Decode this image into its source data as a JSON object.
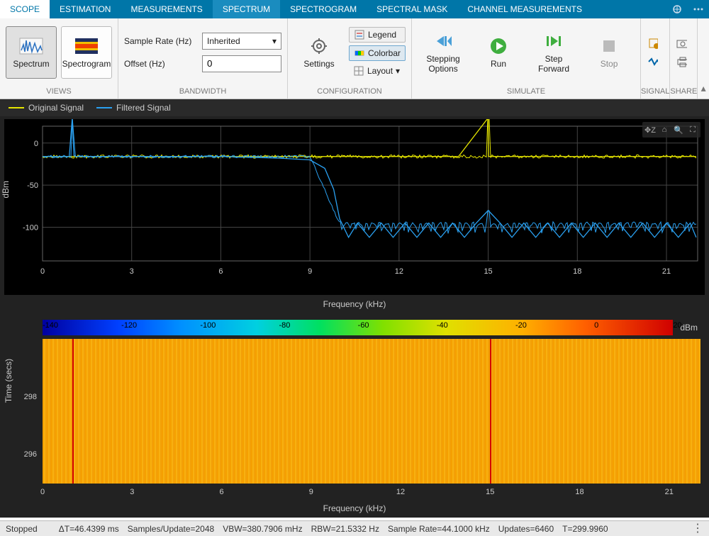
{
  "tabs": {
    "items": [
      "SCOPE",
      "ESTIMATION",
      "MEASUREMENTS",
      "SPECTRUM",
      "SPECTROGRAM",
      "SPECTRAL MASK",
      "CHANNEL MEASUREMENTS"
    ],
    "active_index": 0,
    "highlight_index": 3
  },
  "ribbon": {
    "views": {
      "label": "VIEWS",
      "spectrum_btn": "Spectrum",
      "spectrogram_btn": "Spectrogram"
    },
    "bandwidth": {
      "label": "BANDWIDTH",
      "sample_rate_label": "Sample Rate (Hz)",
      "sample_rate_value": "Inherited",
      "offset_label": "Offset (Hz)",
      "offset_value": "0"
    },
    "configuration": {
      "label": "CONFIGURATION",
      "settings": "Settings",
      "legend": "Legend",
      "colorbar": "Colorbar",
      "layout": "Layout"
    },
    "simulate": {
      "label": "SIMULATE",
      "stepping": "Stepping\nOptions",
      "run": "Run",
      "step_forward": "Step\nForward",
      "stop": "Stop"
    },
    "signal": {
      "label": "SIGNAL"
    },
    "share": {
      "label": "SHARE"
    }
  },
  "legend": {
    "items": [
      {
        "name": "Original Signal",
        "color": "#e6e600"
      },
      {
        "name": "Filtered Signal",
        "color": "#2aa0f0"
      }
    ]
  },
  "chart_data": [
    {
      "type": "line",
      "title": "",
      "xlabel": "Frequency (kHz)",
      "ylabel": "dBm",
      "xlim": [
        0,
        22.05
      ],
      "ylim": [
        -140,
        20
      ],
      "xticks": [
        0,
        3,
        6,
        9,
        12,
        15,
        18,
        21
      ],
      "yticks": [
        0,
        -50,
        -100
      ],
      "series": [
        {
          "name": "Original Signal",
          "color": "#e6e600",
          "x": [
            0,
            1,
            1.01,
            2,
            4,
            6,
            8,
            10,
            12,
            14,
            15,
            15.01,
            16,
            18,
            20,
            22
          ],
          "y": [
            -16,
            -16,
            -16,
            -16,
            -16,
            -16,
            -16,
            -16,
            -16,
            -16,
            30,
            -16,
            -16,
            -16,
            -16,
            -16
          ]
        },
        {
          "name": "Filtered Signal",
          "color": "#2aa0f0",
          "envelope_baseline": true,
          "x": [
            0,
            0.9,
            1,
            1.1,
            2,
            4,
            6,
            8,
            9,
            9.5,
            9.8,
            10,
            10.3,
            10.6,
            11,
            11.4,
            11.8,
            12.2,
            12.6,
            13,
            13.4,
            13.8,
            14.2,
            14.6,
            15,
            15.4,
            15.8,
            16.2,
            16.6,
            17,
            17.4,
            17.8,
            18.2,
            18.6,
            19,
            19.4,
            19.8,
            20.2,
            20.6,
            21,
            21.4,
            21.8,
            22
          ],
          "y": [
            -16,
            -16,
            30,
            -16,
            -16,
            -16,
            -16,
            -18,
            -20,
            -30,
            -55,
            -90,
            -112,
            -95,
            -112,
            -95,
            -112,
            -95,
            -112,
            -95,
            -112,
            -95,
            -112,
            -95,
            -80,
            -95,
            -112,
            -95,
            -112,
            -95,
            -112,
            -95,
            -112,
            -95,
            -112,
            -95,
            -112,
            -95,
            -112,
            -95,
            -112,
            -95,
            -112
          ]
        }
      ]
    },
    {
      "type": "heatmap",
      "title": "",
      "xlabel": "Frequency (kHz)",
      "ylabel": "Time (secs)",
      "xlim": [
        0,
        22.05
      ],
      "ylim": [
        295,
        300
      ],
      "xticks": [
        0,
        3,
        6,
        9,
        12,
        15,
        18,
        21
      ],
      "yticks": [
        296,
        298
      ],
      "colorbar": {
        "unit": "dBm",
        "ticks": [
          -140,
          -120,
          -100,
          -80,
          -60,
          -40,
          -20,
          0,
          20
        ]
      },
      "peak_freqs_khz": [
        1,
        15
      ],
      "background_level_dbm": -15
    }
  ],
  "status": {
    "state": "Stopped",
    "metrics": [
      "ΔT=46.4399 ms",
      "Samples/Update=2048",
      "VBW=380.7906 mHz",
      "RBW=21.5332 Hz",
      "Sample Rate=44.1000 kHz",
      "Updates=6460",
      "T=299.9960"
    ]
  }
}
